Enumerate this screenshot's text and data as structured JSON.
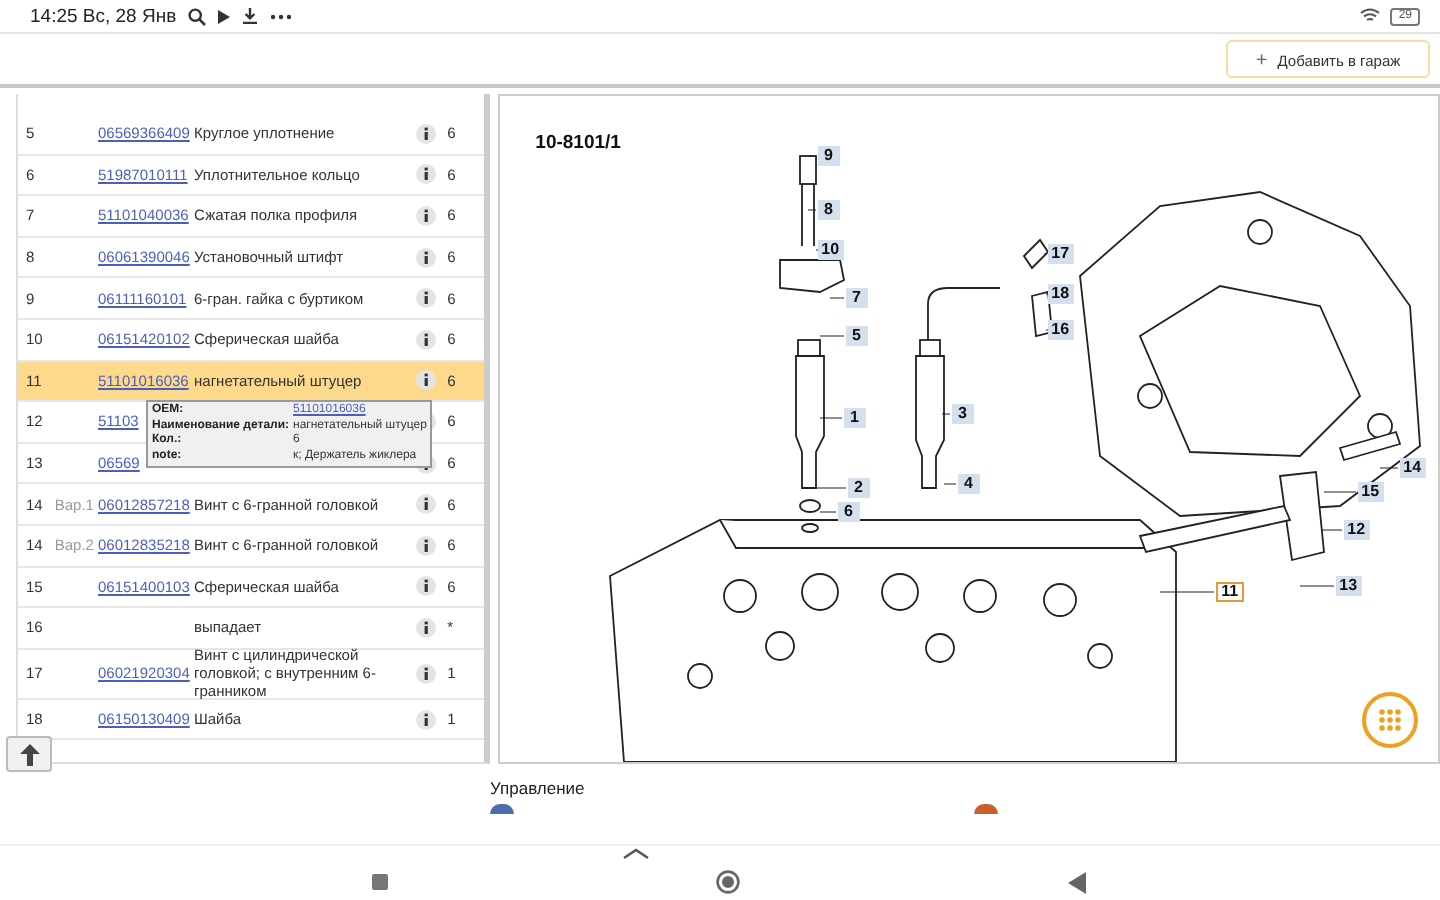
{
  "status_bar": {
    "time": "14:25 Вс, 28 Янв",
    "battery": "29"
  },
  "header": {
    "add_icon": "+",
    "add_button": "Добавить в гараж"
  },
  "parts_table": {
    "rows": [
      {
        "number": "5",
        "part_no": "06569366409",
        "name": "Круглое уплотнение",
        "qty": "6",
        "selected": false
      },
      {
        "number": "6",
        "part_no": "51987010111",
        "name": "Уплотнительное кольцо",
        "qty": "6",
        "selected": false
      },
      {
        "number": "7",
        "part_no": "51101040036",
        "name": "Сжатая полка профиля",
        "qty": "6",
        "selected": false
      },
      {
        "number": "8",
        "part_no": "06061390046",
        "name": "Установочный штифт",
        "qty": "6",
        "selected": false
      },
      {
        "number": "9",
        "part_no": "06111160101",
        "name": "6-гран. гайка с буртиком",
        "qty": "6",
        "selected": false
      },
      {
        "number": "10",
        "part_no": "06151420102",
        "name": "Сферическая шайба",
        "qty": "6",
        "selected": false
      },
      {
        "number": "11",
        "part_no": "51101016036",
        "name": "нагнетательный штуцер",
        "qty": "6",
        "selected": true
      },
      {
        "number": "12",
        "part_no": "51103",
        "qty": "6",
        "selected": false
      },
      {
        "number": "13",
        "part_no": "06569",
        "qty": "6",
        "selected": false
      },
      {
        "number": "14",
        "variant": "Вар.1",
        "part_no": "06012857218",
        "name": "Винт с 6-гранной головкой",
        "qty": "6",
        "selected": false
      },
      {
        "number": "14",
        "variant": "Вар.2",
        "part_no": "06012835218",
        "name": "Винт с 6-гранной головкой",
        "qty": "6",
        "selected": false
      },
      {
        "number": "15",
        "part_no": "06151400103",
        "name": "Сферическая шайба",
        "qty": "6",
        "selected": false
      },
      {
        "number": "16",
        "name": "выпадает",
        "qty": "*",
        "selected": false
      },
      {
        "number": "17",
        "part_no": "06021920304",
        "name": "Винт с цилиндрической головкой; с внутренним 6-гранником",
        "qty": "1",
        "selected": false
      },
      {
        "number": "18",
        "part_no": "06150130409",
        "name": "Шайба",
        "qty": "1",
        "selected": false
      }
    ]
  },
  "tooltip": {
    "fields": [
      {
        "label": "OEM:",
        "value": "51101016036",
        "kind": "link"
      },
      {
        "label": "Наименование детали:",
        "value": "нагнетательный штуцер",
        "kind": "text"
      },
      {
        "label": "Кол.:",
        "value": "6",
        "kind": "text"
      },
      {
        "label": "note:",
        "value": "к; Держатель жиклера",
        "kind": "text"
      }
    ]
  },
  "diagram": {
    "title": "10-8101/1",
    "callouts": [
      {
        "label": "9",
        "selected": false
      },
      {
        "label": "8",
        "selected": false
      },
      {
        "label": "10",
        "selected": false
      },
      {
        "label": "7",
        "selected": false
      },
      {
        "label": "5",
        "selected": false
      },
      {
        "label": "1",
        "selected": false
      },
      {
        "label": "3",
        "selected": false
      },
      {
        "label": "4",
        "selected": false
      },
      {
        "label": "2",
        "selected": false
      },
      {
        "label": "6",
        "selected": false
      },
      {
        "label": "17",
        "selected": false
      },
      {
        "label": "18",
        "selected": false
      },
      {
        "label": "16",
        "selected": false
      },
      {
        "label": "14",
        "selected": false
      },
      {
        "label": "15",
        "selected": false
      },
      {
        "label": "12",
        "selected": false
      },
      {
        "label": "13",
        "selected": false
      },
      {
        "label": "11",
        "selected": true
      }
    ]
  },
  "bottom_section": {
    "title": "Управление"
  }
}
